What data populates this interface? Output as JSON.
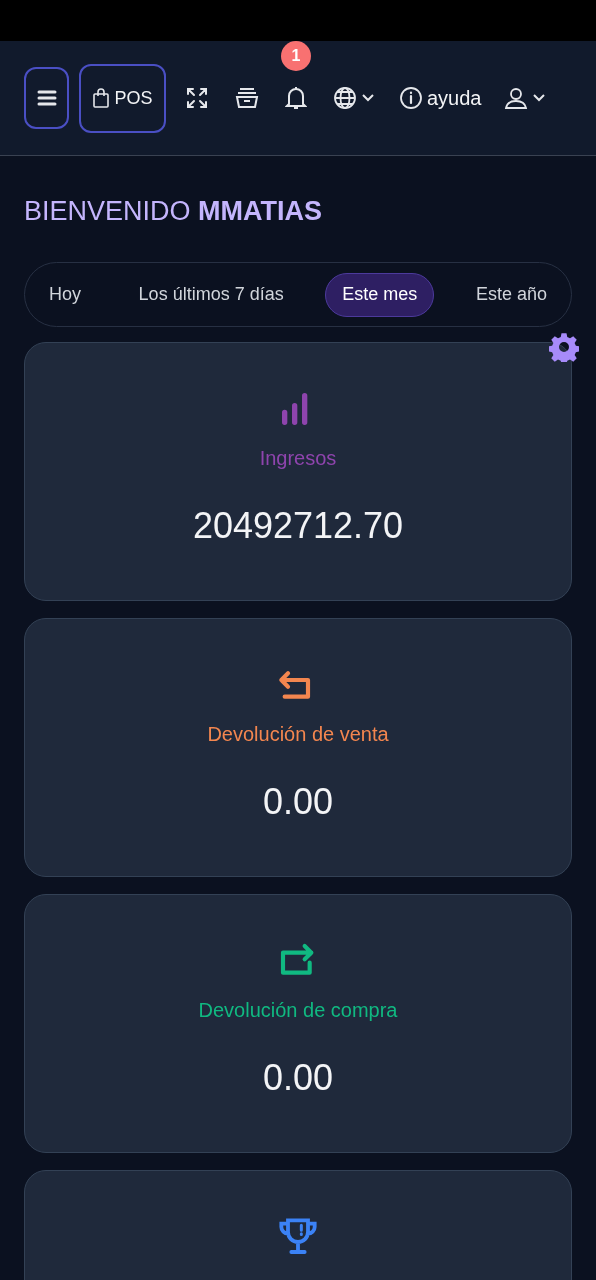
{
  "header": {
    "pos_label": "POS",
    "notification_count": "1",
    "help_label": "ayuda"
  },
  "greeting": "BIENVENIDO **MMATIAS**",
  "tabs": [
    {
      "label": "Hoy",
      "selected": false
    },
    {
      "label": "Los últimos 7 días",
      "selected": false
    },
    {
      "label": "Este mes",
      "selected": true
    },
    {
      "label": "Este año",
      "selected": false
    }
  ],
  "cards": [
    {
      "kind": "income",
      "label": "Ingresos",
      "value": "20492712.70",
      "color": "#8e44ad"
    },
    {
      "kind": "sale_return",
      "label": "Devolución de venta",
      "value": "0.00",
      "color": "#f3864f"
    },
    {
      "kind": "purchase_return",
      "label": "Devolución de compra",
      "value": "0.00",
      "color": "#10b981"
    },
    {
      "kind": "trophy",
      "color": "#3b82f6"
    }
  ]
}
